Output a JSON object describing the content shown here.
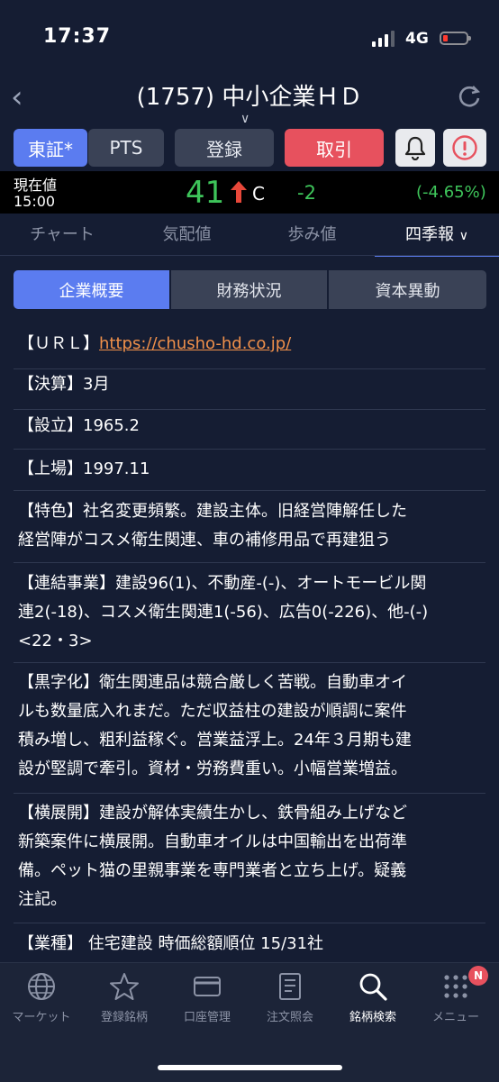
{
  "status": {
    "time": "17:37",
    "network": "4G"
  },
  "nav": {
    "title": "(1757) 中小企業ＨＤ"
  },
  "actions": {
    "tosho": "東証*",
    "pts": "PTS",
    "register": "登録",
    "trade": "取引"
  },
  "price": {
    "label": "現在値",
    "time": "15:00",
    "value": "41",
    "flag": "C",
    "change": "-2",
    "change_pct": "(-4.65%)"
  },
  "tabs": [
    "チャート",
    "気配値",
    "歩み値",
    "四季報"
  ],
  "segments": [
    "企業概要",
    "財務状況",
    "資本異動"
  ],
  "info": {
    "url_label": "【ＵＲＬ】",
    "url": "https://chusho-hd.co.jp/",
    "kessan": "【決算】3月",
    "setsuritsu": "【設立】1965.2",
    "jojo": "【上場】1997.11",
    "tokushoku_1": "【特色】社名変更頻繁。建設主体。旧経営陣解任した",
    "tokushoku_2": "経営陣がコスメ衛生関連、車の補修用品で再建狙う",
    "renketsu_1": "【連結事業】建設96(1)、不動産-(-)、オートモービル関",
    "renketsu_2": "連2(-18)、コスメ衛生関連1(-56)、広告0(-226)、他-(-)",
    "renketsu_3": "<22・3>",
    "kuroji_1": "【黒字化】衛生関連品は競合厳しく苦戦。自動車オイ",
    "kuroji_2": "ルも数量底入れまだ。ただ収益柱の建設が順調に案件",
    "kuroji_3": "積み増し、粗利益稼ぐ。営業益浮上。24年３月期も建",
    "kuroji_4": "設が堅調で牽引。資材・労務費重い。小幅営業増益。",
    "yoko_1": "【横展開】建設が解体実績生かし、鉄骨組み上げなど",
    "yoko_2": "新築案件に横展開。自動車オイルは中国輸出を出荷準",
    "yoko_3": "備。ペット猫の里親事業を専門業者と立ち上げ。疑義",
    "yoko_4": "注記。",
    "gyoshu": "【業種】 住宅建設 時価総額順位 15/31社"
  },
  "bottom_nav": [
    "マーケット",
    "登録銘柄",
    "口座管理",
    "注文照会",
    "銘柄検索",
    "メニュー"
  ],
  "badge": "N"
}
